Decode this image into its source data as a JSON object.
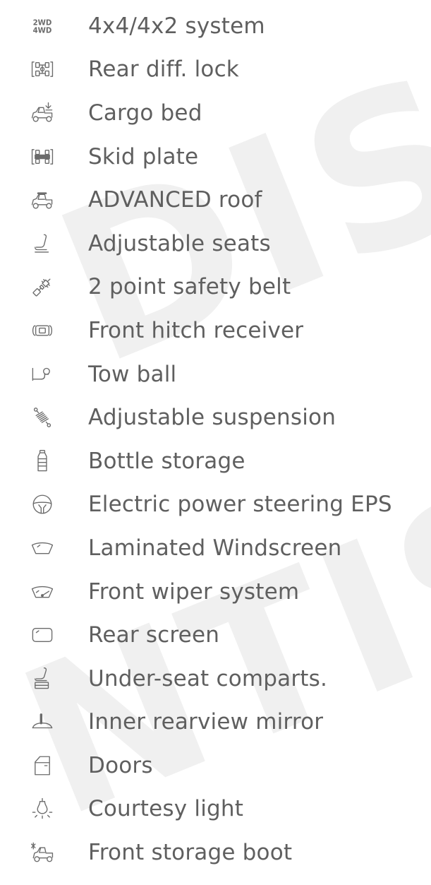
{
  "watermark": {
    "text_top": "DISI",
    "text_bottom": "NTIS"
  },
  "features": [
    {
      "label": "4x4/4x2 system",
      "icon": "drive-mode-icon"
    },
    {
      "label": "Rear diff. lock",
      "icon": "diff-lock-icon"
    },
    {
      "label": "Cargo bed",
      "icon": "cargo-bed-icon"
    },
    {
      "label": "Skid plate",
      "icon": "skid-plate-icon"
    },
    {
      "label": "ADVANCED roof",
      "icon": "roof-icon"
    },
    {
      "label": "Adjustable seats",
      "icon": "seat-icon"
    },
    {
      "label": "2 point safety belt",
      "icon": "seat-belt-icon"
    },
    {
      "label": "Front hitch receiver",
      "icon": "hitch-receiver-icon"
    },
    {
      "label": "Tow ball",
      "icon": "tow-ball-icon"
    },
    {
      "label": "Adjustable suspension",
      "icon": "suspension-icon"
    },
    {
      "label": "Bottle storage",
      "icon": "bottle-icon"
    },
    {
      "label": "Electric power steering EPS",
      "icon": "steering-wheel-icon"
    },
    {
      "label": "Laminated Windscreen",
      "icon": "windscreen-icon"
    },
    {
      "label": "Front wiper system",
      "icon": "wiper-icon"
    },
    {
      "label": "Rear screen",
      "icon": "rear-screen-icon"
    },
    {
      "label": "Under-seat comparts.",
      "icon": "under-seat-storage-icon"
    },
    {
      "label": "Inner rearview mirror",
      "icon": "mirror-icon"
    },
    {
      "label": "Doors",
      "icon": "door-icon"
    },
    {
      "label": "Courtesy light",
      "icon": "courtesy-light-icon"
    },
    {
      "label": "Front storage boot",
      "icon": "front-storage-icon"
    }
  ]
}
